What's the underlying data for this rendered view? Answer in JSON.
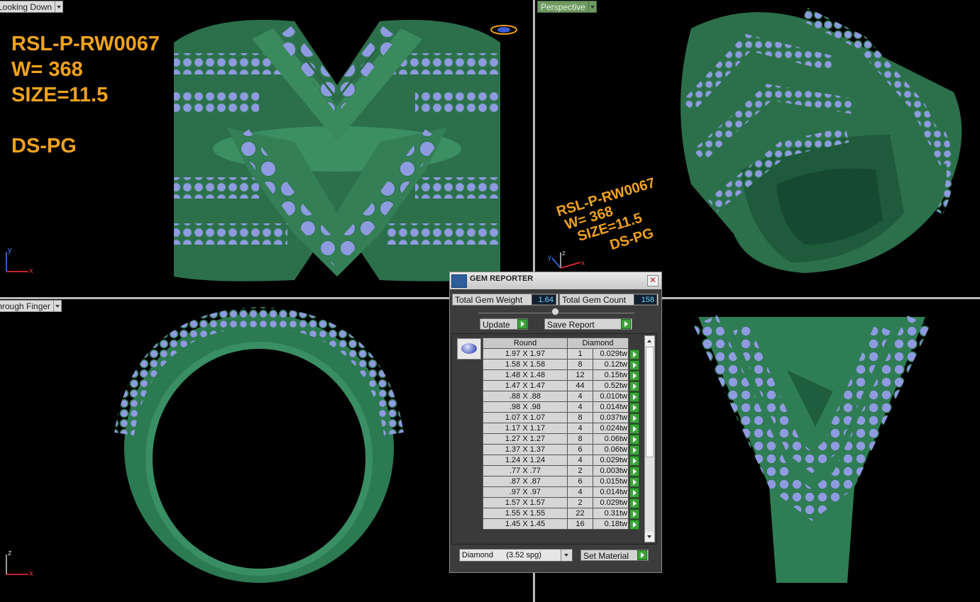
{
  "viewports": {
    "top_left": {
      "tab_label": "Looking Down"
    },
    "top_right": {
      "tab_label": "Perspective"
    },
    "bottom_left": {
      "tab_label": "Through Finger"
    }
  },
  "design_label": {
    "code": "RSL-P-RW0067",
    "weight": "W= 368",
    "size": "SIZE=11.5",
    "finish": "DS-PG"
  },
  "axes": {
    "top_left": [
      "y",
      "x"
    ],
    "top_right": [
      "y",
      "z",
      "x"
    ],
    "bottom_left": [
      "z",
      "x"
    ]
  },
  "colors": {
    "metal": "#2f7a52",
    "gem": "#8f9be0",
    "label": "#f0a21e"
  },
  "gem_reporter": {
    "title": "GEM REPORTER",
    "total_weight_label": "Total Gem Weight",
    "total_weight_value": "1.64",
    "total_count_label": "Total Gem Count",
    "total_count_value": "158",
    "update_label": "Update",
    "save_report_label": "Save Report",
    "table_headers": [
      "Round",
      "Diamond"
    ],
    "rows": [
      {
        "size": "1.97 X 1.97",
        "count": "1",
        "weight": "0.029tw"
      },
      {
        "size": "1.58 X 1.58",
        "count": "8",
        "weight": "0.12tw"
      },
      {
        "size": "1.48 X 1.48",
        "count": "12",
        "weight": "0.15tw"
      },
      {
        "size": "1.47 X 1.47",
        "count": "44",
        "weight": "0.52tw"
      },
      {
        "size": ".88 X .88",
        "count": "4",
        "weight": "0.010tw"
      },
      {
        "size": ".98 X .98",
        "count": "4",
        "weight": "0.014tw"
      },
      {
        "size": "1.07 X 1.07",
        "count": "8",
        "weight": "0.037tw"
      },
      {
        "size": "1.17 X 1.17",
        "count": "4",
        "weight": "0.024tw"
      },
      {
        "size": "1.27 X 1.27",
        "count": "8",
        "weight": "0.06tw"
      },
      {
        "size": "1.37 X 1.37",
        "count": "6",
        "weight": "0.06tw"
      },
      {
        "size": "1.24 X 1.24",
        "count": "4",
        "weight": "0.029tw"
      },
      {
        "size": ".77 X .77",
        "count": "2",
        "weight": "0.003tw"
      },
      {
        "size": ".87 X .87",
        "count": "6",
        "weight": "0.015tw"
      },
      {
        "size": ".97 X .97",
        "count": "4",
        "weight": "0.014tw"
      },
      {
        "size": "1.57 X 1.57",
        "count": "2",
        "weight": "0.029tw"
      },
      {
        "size": "1.55 X 1.55",
        "count": "22",
        "weight": "0.31tw"
      },
      {
        "size": "1.45 X 1.45",
        "count": "16",
        "weight": "0.18tw"
      }
    ],
    "material_value": "Diamond      (3.52 spg)",
    "set_material_label": "Set Material"
  }
}
